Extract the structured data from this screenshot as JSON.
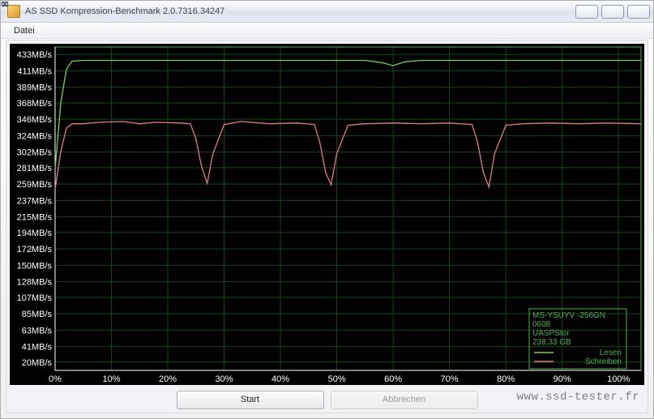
{
  "window": {
    "title": "AS SSD Kompression-Benchmark 2.0.7316.34247"
  },
  "menu": {
    "file": "Datei"
  },
  "buttons": {
    "start": "Start",
    "abort": "Abbrechen"
  },
  "legend": {
    "device_line1": "MS-YSUYV -256GN",
    "device_line2": "0608",
    "controller": "UASPStor",
    "capacity": "238,33 GB",
    "read": "Lesen",
    "write": "Schreiben"
  },
  "watermark": "www.ssd-tester.fr",
  "colors": {
    "read": "#7bcf4b",
    "write": "#e27a87",
    "frame": "#4db24d",
    "grid": "#124a12"
  },
  "chart_data": {
    "type": "line",
    "xlabel": "",
    "ylabel": "",
    "title": "",
    "x_unit": "%",
    "y_unit": "MB/s",
    "xlim": [
      0,
      104
    ],
    "ylim": [
      9,
      443
    ],
    "x_ticks": [
      0,
      10,
      20,
      30,
      40,
      50,
      60,
      70,
      80,
      90,
      100
    ],
    "y_ticks_values": [
      20,
      41,
      63,
      85,
      107,
      128,
      150,
      172,
      194,
      215,
      237,
      259,
      281,
      302,
      324,
      346,
      368,
      389,
      411,
      433
    ],
    "y_ticks_labels": [
      "20MB/s",
      "41MB/s",
      "63MB/s",
      "85MB/s",
      "107MB/s",
      "128MB/s",
      "150MB/s",
      "172MB/s",
      "194MB/s",
      "215MB/s",
      "237MB/s",
      "259MB/s",
      "281MB/s",
      "302MB/s",
      "324MB/s",
      "346MB/s",
      "368MB/s",
      "389MB/s",
      "411MB/s",
      "433MB/s"
    ],
    "series": [
      {
        "name": "Lesen",
        "color": "#7bcf4b",
        "x": [
          0,
          1,
          2,
          3,
          5,
          8,
          12,
          15,
          20,
          25,
          30,
          35,
          40,
          45,
          50,
          55,
          58,
          60,
          62,
          65,
          70,
          75,
          80,
          85,
          90,
          95,
          100,
          104
        ],
        "y": [
          280,
          368,
          413,
          424,
          425,
          425,
          425,
          425,
          425,
          425,
          425,
          425,
          425,
          425,
          425,
          425,
          422,
          418,
          423,
          425,
          425,
          425,
          425,
          425,
          425,
          425,
          425,
          425
        ]
      },
      {
        "name": "Schreiben",
        "color": "#e27a87",
        "x": [
          0,
          1,
          2,
          3,
          5,
          8,
          12,
          15,
          18,
          22,
          24,
          25,
          26,
          27,
          28,
          30,
          33,
          38,
          43,
          46,
          47,
          48,
          49,
          50,
          52,
          55,
          60,
          65,
          70,
          74,
          75,
          76,
          77,
          78,
          80,
          83,
          88,
          93,
          98,
          104
        ],
        "y": [
          252,
          303,
          334,
          340,
          340,
          342,
          343,
          340,
          342,
          341,
          340,
          320,
          282,
          260,
          300,
          339,
          343,
          340,
          341,
          339,
          315,
          275,
          258,
          300,
          338,
          340,
          341,
          340,
          341,
          339,
          315,
          275,
          255,
          300,
          338,
          340,
          341,
          340,
          341,
          340
        ]
      }
    ]
  }
}
